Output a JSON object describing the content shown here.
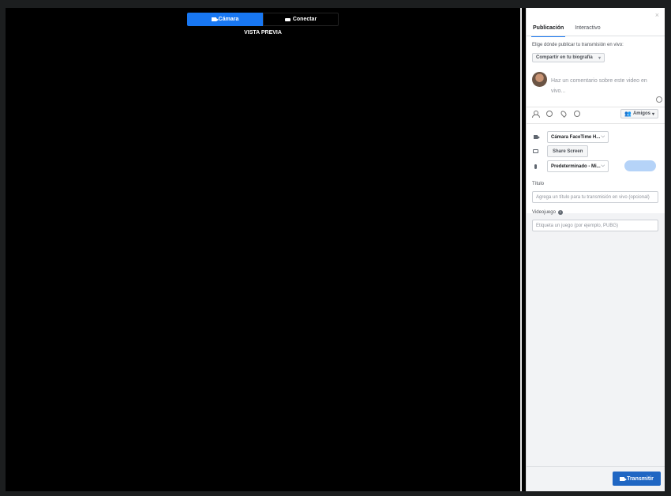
{
  "preview": {
    "camera_tab": "Cámara",
    "connect_tab": "Conectar",
    "preview_label": "VISTA PREVIA"
  },
  "panel": {
    "close": "×",
    "tabs": [
      "Publicación",
      "Interactivo"
    ],
    "choose_where": "Elige dónde publicar tu transmisión en vivo:",
    "share_option": "Compartir en tu biografía",
    "comment_placeholder": "Haz un comentario sobre este video en vivo...",
    "audience": "Amigos",
    "camera_source": "Cámara FaceTime H...",
    "share_screen": "Share Screen",
    "mic_source": "Predeterminado - Mi...",
    "title_label": "Título",
    "title_placeholder": "Agrega un título para tu transmisión en vivo (opcional)",
    "game_label": "Videojuego",
    "game_placeholder": "Etiqueta un juego (por ejemplo, PUBG)",
    "go_live": "Transmitir"
  },
  "icons": {
    "tag-people": "person-icon",
    "feeling": "smile-icon",
    "location": "pin-icon",
    "activity": "emoji-icon",
    "camera-source": "video-camera-icon",
    "screen-source": "monitor-icon",
    "mic-source": "microphone-icon",
    "info": "info-icon"
  },
  "colors": {
    "accent": "#1877f2",
    "go_live_button": "#1f66c3",
    "audio_meter": "#b5d3f8"
  }
}
